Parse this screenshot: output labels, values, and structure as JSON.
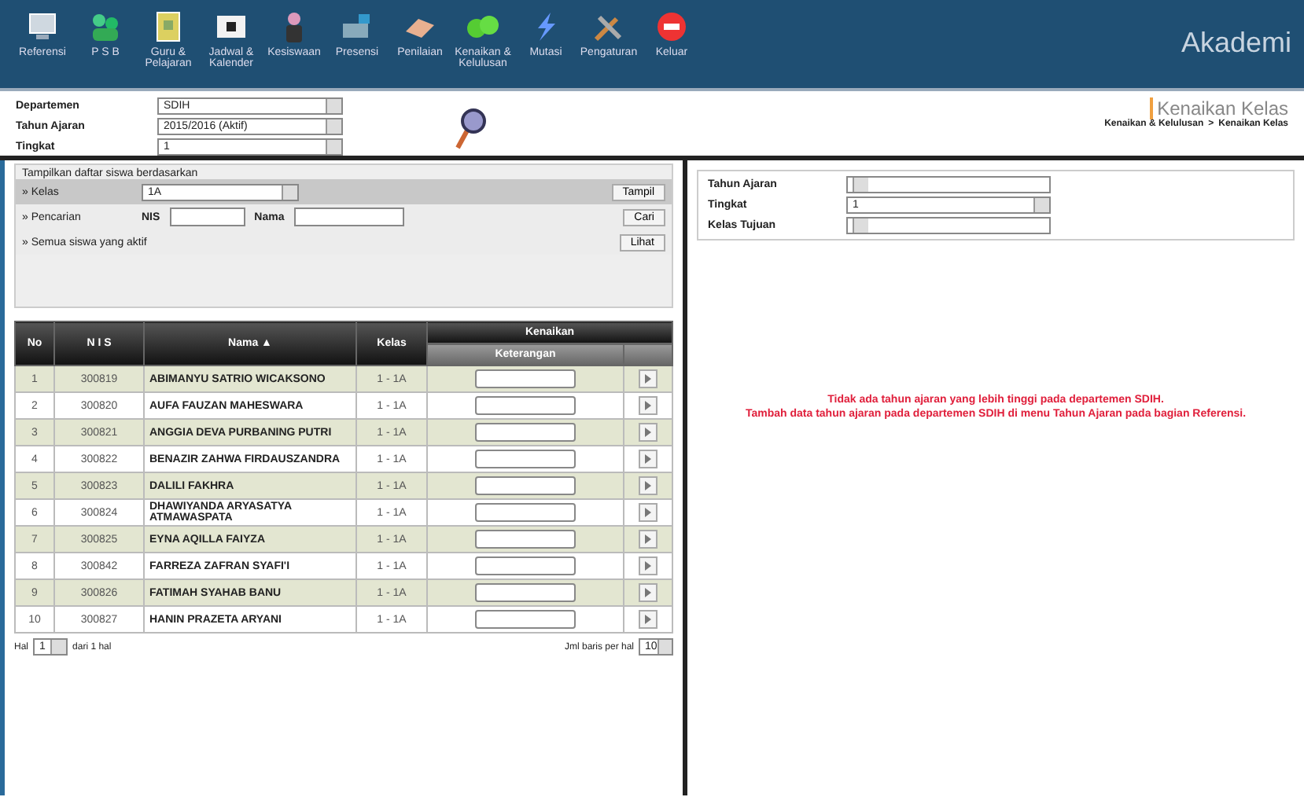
{
  "toolbar": {
    "items": [
      {
        "label": "Referensi"
      },
      {
        "label": "P S B"
      },
      {
        "label": "Guru & Pelajaran"
      },
      {
        "label": "Jadwal & Kalender"
      },
      {
        "label": "Kesiswaan"
      },
      {
        "label": "Presensi"
      },
      {
        "label": "Penilaian"
      },
      {
        "label": "Kenaikan & Kelulusan"
      },
      {
        "label": "Mutasi"
      },
      {
        "label": "Pengaturan"
      },
      {
        "label": "Keluar"
      }
    ],
    "logo": "Akademi"
  },
  "header": {
    "filters": [
      {
        "label": "Departemen",
        "value": "SDIH"
      },
      {
        "label": "Tahun Ajaran",
        "value": "2015/2016 (Aktif)"
      },
      {
        "label": "Tingkat",
        "value": "1"
      }
    ],
    "page_title": "Kenaikan Kelas",
    "breadcrumb": [
      "Kenaikan & Kelulusan",
      "Kenaikan Kelas"
    ],
    "breadcrumb_separator": ">"
  },
  "search_panel": {
    "legend": "Tampilkan daftar siswa berdasarkan",
    "options": [
      {
        "kind": "select",
        "label": "» Kelas",
        "value": "1A",
        "button": "Tampil",
        "selected": true
      },
      {
        "kind": "search",
        "label": "» Pencarian",
        "fields": [
          "NIS",
          "Nama"
        ],
        "button": "Cari",
        "selected": false
      },
      {
        "kind": "plain",
        "label": "» Semua siswa yang aktif",
        "button": "Lihat",
        "selected": false
      }
    ]
  },
  "table": {
    "columns": [
      "No",
      "N I S",
      "Nama ▲",
      "Kelas"
    ],
    "group_column": "Kenaikan",
    "sub_column": "Keterangan",
    "rows": [
      {
        "no": "1",
        "nis": "300819",
        "nama": "ABIMANYU SATRIO WICAKSONO",
        "kelas": "1 - 1A"
      },
      {
        "no": "2",
        "nis": "300820",
        "nama": "AUFA FAUZAN MAHESWARA",
        "kelas": "1 - 1A"
      },
      {
        "no": "3",
        "nis": "300821",
        "nama": "ANGGIA DEVA PURBANING PUTRI",
        "kelas": "1 - 1A"
      },
      {
        "no": "4",
        "nis": "300822",
        "nama": "BENAZIR ZAHWA FIRDAUSZANDRA",
        "kelas": "1 - 1A"
      },
      {
        "no": "5",
        "nis": "300823",
        "nama": "DALILI FAKHRA",
        "kelas": "1 - 1A"
      },
      {
        "no": "6",
        "nis": "300824",
        "nama": "DHAWIYANDA ARYASATYA ATMAWASPATA",
        "kelas": "1 - 1A"
      },
      {
        "no": "7",
        "nis": "300825",
        "nama": "EYNA AQILLA FAIYZA",
        "kelas": "1 - 1A"
      },
      {
        "no": "8",
        "nis": "300842",
        "nama": "FARREZA ZAFRAN SYAFI'I",
        "kelas": "1 - 1A"
      },
      {
        "no": "9",
        "nis": "300826",
        "nama": "FATIMAH SYAHAB BANU",
        "kelas": "1 - 1A"
      },
      {
        "no": "10",
        "nis": "300827",
        "nama": "HANIN PRAZETA ARYANI",
        "kelas": "1 - 1A"
      }
    ]
  },
  "pagination": {
    "page_label": "Hal",
    "page": "1",
    "of_label": "dari 1 hal",
    "rows_label": "Jml baris per hal",
    "rows_value": "10"
  },
  "right_form": {
    "fields": [
      {
        "label": "Tahun Ajaran"
      },
      {
        "label": "Tingkat",
        "value": "1"
      },
      {
        "label": "Kelas Tujuan"
      }
    ]
  },
  "message": [
    "Tidak ada tahun ajaran yang lebih tinggi pada departemen SDIH.",
    "Tambah data tahun ajaran pada departemen SDIH di menu Tahun Ajaran pada bagian Referensi."
  ]
}
